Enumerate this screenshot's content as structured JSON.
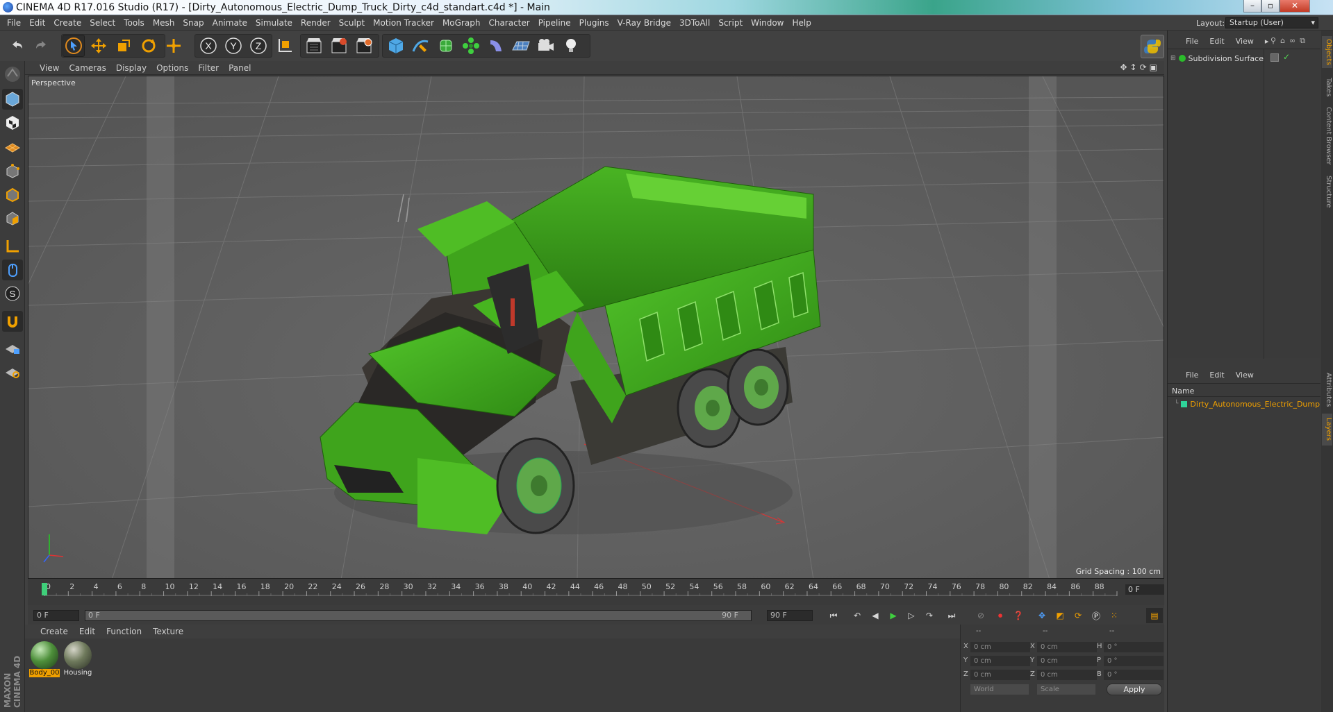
{
  "window": {
    "title": "CINEMA 4D R17.016 Studio (R17) - [Dirty_Autonomous_Electric_Dump_Truck_Dirty_c4d_standart.c4d *] - Main",
    "controls": [
      "minimize",
      "maximize",
      "close"
    ]
  },
  "menubar": {
    "items": [
      "File",
      "Edit",
      "Create",
      "Select",
      "Tools",
      "Mesh",
      "Snap",
      "Animate",
      "Simulate",
      "Render",
      "Sculpt",
      "Motion Tracker",
      "MoGraph",
      "Character",
      "Pipeline",
      "Plugins",
      "V-Ray Bridge",
      "3DToAll",
      "Script",
      "Window",
      "Help"
    ],
    "layout_label": "Layout:",
    "layout_value": "Startup (User)"
  },
  "toolbar": {
    "icons": [
      "undo-icon",
      "redo-icon",
      "select-arrow-icon",
      "move-icon",
      "scale-icon",
      "rotate-icon",
      "transform-icon",
      "x-axis-icon",
      "y-axis-icon",
      "z-axis-icon",
      "coordinate-system-icon",
      "render-view-icon",
      "render-picture-viewer-icon",
      "render-settings-icon",
      "cube-icon",
      "pen-icon",
      "subdivision-icon",
      "cloner-icon",
      "deformer-icon",
      "floor-icon",
      "camera-icon",
      "light-icon",
      "python-icon"
    ],
    "axis_labels": [
      "X",
      "Y",
      "Z"
    ]
  },
  "viewport": {
    "menu": [
      "View",
      "Cameras",
      "Display",
      "Options",
      "Filter",
      "Panel"
    ],
    "label": "Perspective",
    "grid_spacing": "Grid Spacing : 100 cm"
  },
  "timeline": {
    "ticks": [
      "0",
      "2",
      "4",
      "6",
      "8",
      "10",
      "12",
      "14",
      "16",
      "18",
      "20",
      "22",
      "24",
      "26",
      "28",
      "30",
      "32",
      "34",
      "36",
      "38",
      "40",
      "42",
      "44",
      "46",
      "48",
      "50",
      "52",
      "54",
      "56",
      "58",
      "60",
      "62",
      "64",
      "66",
      "68",
      "70",
      "72",
      "74",
      "76",
      "78",
      "80",
      "82",
      "84",
      "86",
      "88",
      "90"
    ],
    "current_frame": "0 F"
  },
  "transport": {
    "start_frame": "0 F",
    "range_start": "0 F",
    "range_end": "90 F",
    "end_frame": "90 F"
  },
  "materials": {
    "menu": [
      "Create",
      "Edit",
      "Function",
      "Texture"
    ],
    "items": [
      {
        "name": "Body_00",
        "selected": true
      },
      {
        "name": "Housing",
        "selected": false
      }
    ]
  },
  "coordinates": {
    "header": [
      "--",
      "--",
      "--"
    ],
    "rows": [
      {
        "axis": "X",
        "pos": "0 cm",
        "axis2": "X",
        "size": "0 cm",
        "axis3": "H",
        "rot": "0 °"
      },
      {
        "axis": "Y",
        "pos": "0 cm",
        "axis2": "Y",
        "size": "0 cm",
        "axis3": "P",
        "rot": "0 °"
      },
      {
        "axis": "Z",
        "pos": "0 cm",
        "axis2": "Z",
        "size": "0 cm",
        "axis3": "B",
        "rot": "0 °"
      }
    ],
    "mode": "World",
    "size_mode": "Scale",
    "apply": "Apply"
  },
  "objects_panel": {
    "menu": [
      "File",
      "Edit",
      "View"
    ],
    "items": [
      {
        "name": "Subdivision Surface"
      }
    ]
  },
  "layers_panel": {
    "menu": [
      "File",
      "Edit",
      "View"
    ],
    "header": "Name",
    "items": [
      {
        "name": "Dirty_Autonomous_Electric_Dump",
        "color": "#2fd39a"
      }
    ]
  },
  "side_tabs": [
    "Objects",
    "Takes",
    "Content Browser",
    "Structure",
    "Attributes",
    "Layers"
  ],
  "branding": "MAXON CINEMA 4D",
  "colors": {
    "accent": "#f0a000",
    "truck_green": "#3fa41c",
    "selection_orange": "#f0a000"
  }
}
